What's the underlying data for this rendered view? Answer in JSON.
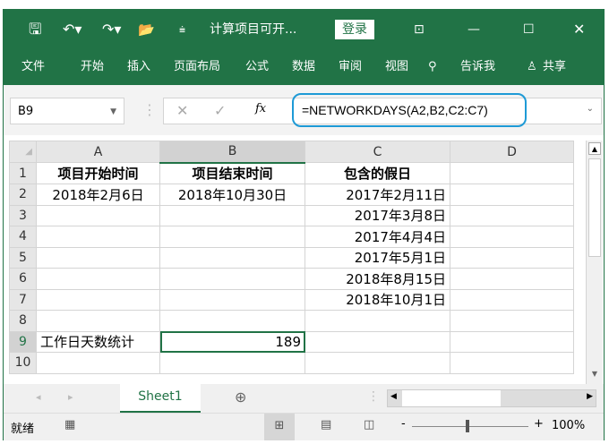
{
  "title_bar": {
    "title": "计算项目可开...",
    "login": "登录"
  },
  "ribbon_tabs": [
    "文件",
    "开始",
    "插入",
    "页面布局",
    "公式",
    "数据",
    "审阅",
    "视图",
    "告诉我",
    "共享"
  ],
  "formula_bar": {
    "name_box": "B9",
    "formula": "=NETWORKDAYS(A2,B2,C2:C7)",
    "fx": "fx"
  },
  "columns": [
    "A",
    "B",
    "C",
    "D"
  ],
  "rows": [
    {
      "n": "1",
      "A": "项目开始时间",
      "B": "项目结束时间",
      "C": "包含的假日",
      "D": ""
    },
    {
      "n": "2",
      "A": "2018年2月6日",
      "B": "2018年10月30日",
      "C": "2017年2月11日",
      "D": ""
    },
    {
      "n": "3",
      "A": "",
      "B": "",
      "C": "2017年3月8日",
      "D": ""
    },
    {
      "n": "4",
      "A": "",
      "B": "",
      "C": "2017年4月4日",
      "D": ""
    },
    {
      "n": "5",
      "A": "",
      "B": "",
      "C": "2017年5月1日",
      "D": ""
    },
    {
      "n": "6",
      "A": "",
      "B": "",
      "C": "2018年8月15日",
      "D": ""
    },
    {
      "n": "7",
      "A": "",
      "B": "",
      "C": "2018年10月1日",
      "D": ""
    },
    {
      "n": "8",
      "A": "",
      "B": "",
      "C": "",
      "D": ""
    },
    {
      "n": "9",
      "A": "工作日天数统计",
      "B": "189",
      "C": "",
      "D": ""
    },
    {
      "n": "10",
      "A": "",
      "B": "",
      "C": "",
      "D": ""
    }
  ],
  "sheet_tab": "Sheet1",
  "status": {
    "ready": "就绪",
    "zoom": "100%"
  }
}
